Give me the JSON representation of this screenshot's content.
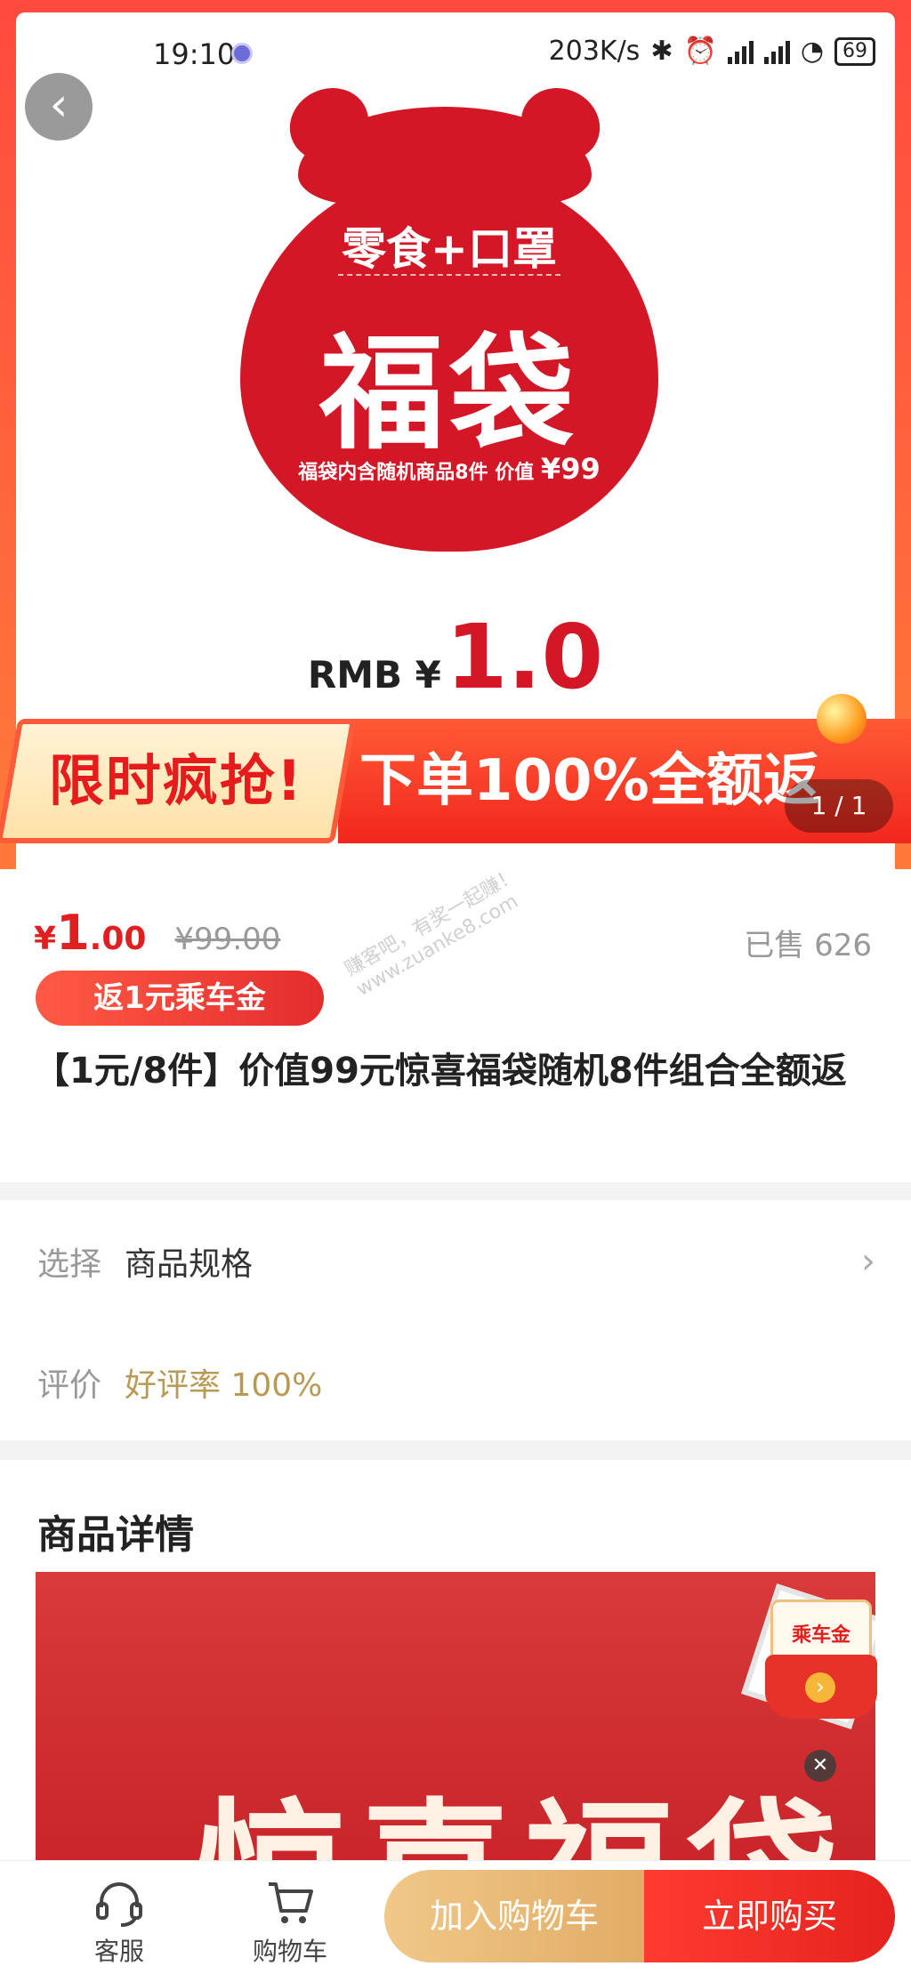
{
  "status_bar": {
    "time": "19:10",
    "speed": "203K/s",
    "battery": "69"
  },
  "hero": {
    "bag_subtitle": "零食+口罩",
    "bag_title": "福袋",
    "bag_note": "福袋内含随机商品8件  价值",
    "bag_value": "¥99",
    "price_label": "RMB ¥",
    "price_value": "1.0",
    "banner_left": "限时疯抢!",
    "banner_right": "下单100%全额返",
    "pager": "1 / 1"
  },
  "product": {
    "currency": "¥",
    "price_int": "1",
    "price_dec": ".00",
    "original_price": "¥99.00",
    "sold": "已售 626",
    "rebate_tag": "返1元乘车金",
    "title": "【1元/8件】价值99元惊喜福袋随机8件组合全额返",
    "watermark_line1": "赚客吧，有奖一起赚！",
    "watermark_line2": "www.zuanke8.com"
  },
  "spec": {
    "select_label": "选择",
    "select_value": "商品规格",
    "review_label": "评价",
    "review_value": "好评率 100%"
  },
  "detail": {
    "heading": "商品详情",
    "banner_text": "惊喜福袋",
    "coupon_text": "乘车金"
  },
  "bottom_bar": {
    "service_label": "客服",
    "cart_label": "购物车",
    "add_cart_label": "加入购物车",
    "buy_now_label": "立即购买"
  },
  "colors": {
    "primary_red": "#e02020",
    "gold": "#e2ac66",
    "review_gold": "#b89a55"
  }
}
